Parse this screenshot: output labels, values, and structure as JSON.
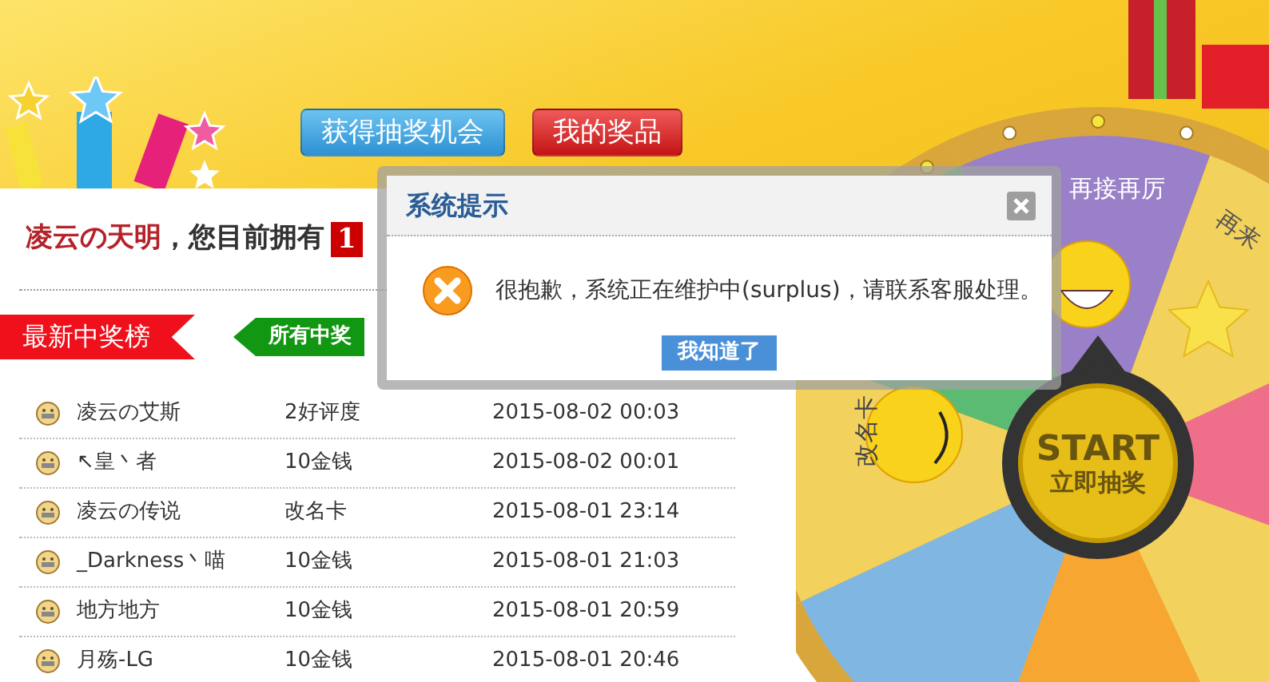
{
  "header": {
    "buttons": [
      {
        "label": "获得抽奖机会",
        "kind": "blue"
      },
      {
        "label": "我的奖品",
        "kind": "red"
      }
    ]
  },
  "greeting": {
    "user": "凌云の天明",
    "text": "，您目前拥有",
    "count": "1"
  },
  "tabs": [
    {
      "label": "最新中奖榜",
      "selected": true
    },
    {
      "label": "所有中奖",
      "selected": false
    }
  ],
  "winners": [
    {
      "name": "凌云の艾斯",
      "prize": "2好评度",
      "time": "2015-08-02 00:03"
    },
    {
      "name": "↖皇丶者",
      "prize": "10金钱",
      "time": "2015-08-02 00:01"
    },
    {
      "name": "凌云の传说",
      "prize": "改名卡",
      "time": "2015-08-01 23:14"
    },
    {
      "name": "_Darkness丶喵",
      "prize": "10金钱",
      "time": "2015-08-01 21:03"
    },
    {
      "name": "地方地方",
      "prize": "10金钱",
      "time": "2015-08-01 20:59"
    },
    {
      "name": "月殇-LG",
      "prize": "10金钱",
      "time": "2015-08-01 20:46"
    }
  ],
  "wheel": {
    "segments": [
      {
        "label": "再接再厉",
        "kind": "top"
      },
      {
        "label": "再来",
        "kind": "right"
      },
      {
        "label": "改名卡",
        "kind": "left"
      }
    ],
    "button": {
      "title": "START",
      "subtitle": "立即抽奖"
    }
  },
  "dialog": {
    "title": "系统提示",
    "message": "很抱歉，系统正在维护中(surplus)，请联系客服处理。",
    "button": "我知道了"
  }
}
